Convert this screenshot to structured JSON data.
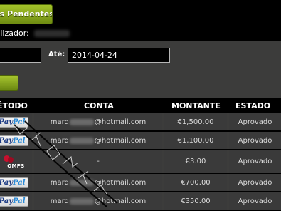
{
  "header": {
    "tab_label": "ntos Pendentes",
    "user_label": "tilizador:"
  },
  "filter": {
    "ate_label": "Até:",
    "date_to": "2014-04-24"
  },
  "table": {
    "columns": [
      "ÉTODO",
      "CONTA",
      "MONTANTE",
      "ESTADO"
    ],
    "rows": [
      {
        "method_logo": "PayPal",
        "account_prefix": "marq",
        "account_suffix": "@hotmail.com",
        "amount": "€1,500.00",
        "status": "Aprovado"
      },
      {
        "method_logo": "PayPal",
        "account_prefix": "marq",
        "account_suffix": "@hotmail.com",
        "amount": "€1,100.00",
        "status": "Aprovado"
      },
      {
        "method_logo": "OMPS",
        "account_prefix": "-",
        "account_suffix": "",
        "amount": "€3.00",
        "status": "Aprovado"
      },
      {
        "method_logo": "PayPal",
        "account_prefix": "marq",
        "account_suffix": "@hotmail.com",
        "amount": "€700.00",
        "status": "Aprovado"
      },
      {
        "method_logo": "PayPal",
        "account_prefix": "marq",
        "account_suffix": "@hotmail.com",
        "amount": "€350.00",
        "status": "Aprovado"
      }
    ]
  },
  "logos": {
    "paypal_a": "Pay",
    "paypal_b": "Pal",
    "comps_word": "OMPS"
  },
  "colors": {
    "accent_green": "#8aae1c",
    "panel_gray": "#3c3c3b",
    "background": "#000000"
  }
}
